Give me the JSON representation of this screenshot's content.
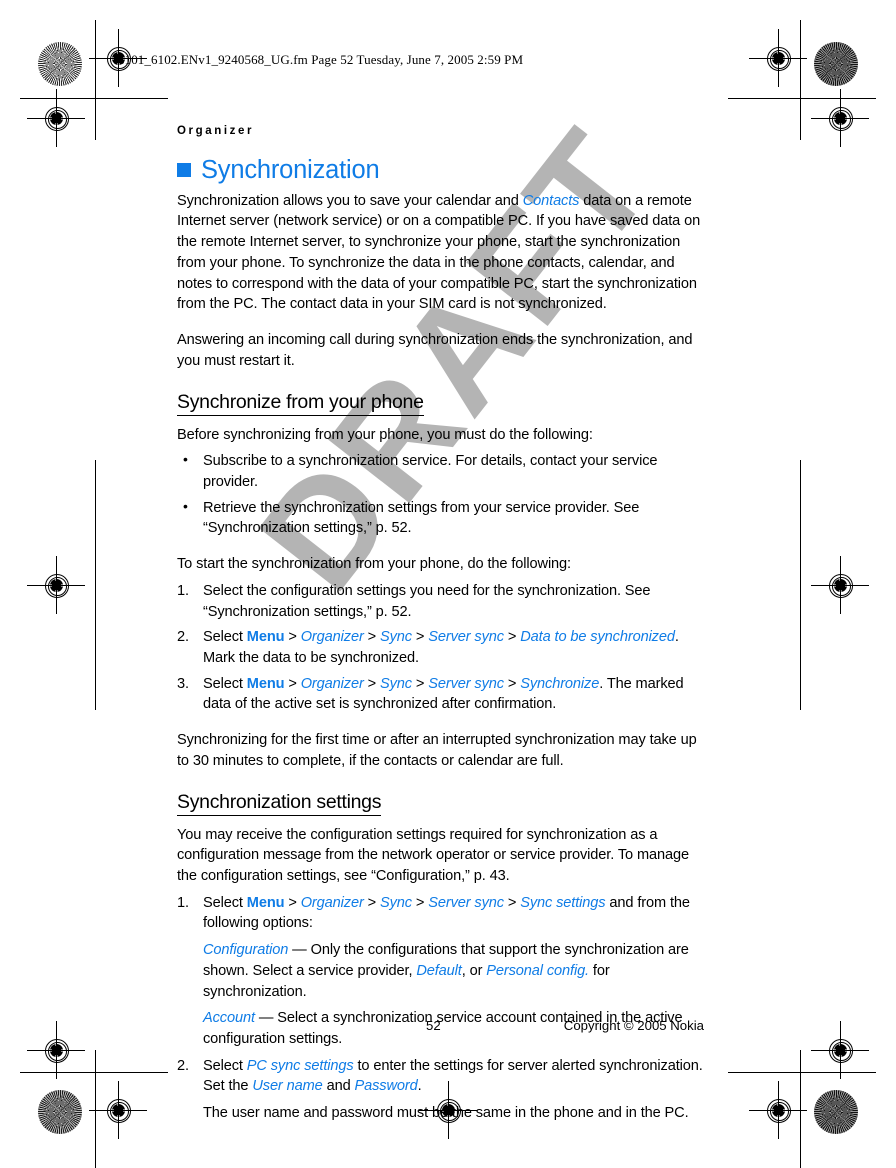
{
  "print_header": {
    "text": "6101_6102.ENv1_9240568_UG.fm  Page 52  Tuesday, June 7, 2005  2:59 PM"
  },
  "watermark": {
    "text": "DRAFT"
  },
  "running_head": {
    "text": "Organizer"
  },
  "chapter": {
    "title": "Synchronization",
    "accent_color": "#0f7ce6"
  },
  "intro": {
    "p1_a": "Synchronization allows you to save your calendar and ",
    "p1_term": "Contacts",
    "p1_b": " data on a remote Internet server (network service) or on a compatible PC. If you have saved data on the remote Internet server, to synchronize your phone, start the synchronization from your phone. To synchronize the data in the phone contacts, calendar, and notes to correspond with the data of your compatible PC, start the synchronization from the PC. The contact data in your SIM card is not synchronized.",
    "p2": "Answering an incoming call during synchronization ends the synchronization, and you must restart it."
  },
  "section_phone": {
    "heading": "Synchronize from your phone",
    "lead": "Before synchronizing from your phone, you must do the following:",
    "bullets": [
      "Subscribe to a synchronization service. For details, contact your service provider.",
      "Retrieve the synchronization settings from your service provider. See “Synchronization settings,” p. 52."
    ],
    "lead2": "To start the synchronization from your phone, do the following:",
    "steps": [
      {
        "num": "1.",
        "text": "Select the configuration settings you need for the synchronization. See “Synchronization settings,” p. 52."
      },
      {
        "num": "2.",
        "prefix": "Select ",
        "menu": "Menu",
        "path": [
          "Organizer",
          "Sync",
          "Server sync",
          "Data to be synchronized"
        ],
        "suffix": ". Mark the data to be synchronized."
      },
      {
        "num": "3.",
        "prefix": "Select ",
        "menu": "Menu",
        "path": [
          "Organizer",
          "Sync",
          "Server sync",
          "Synchronize"
        ],
        "suffix": ". The marked data of the active set is synchronized after confirmation."
      }
    ],
    "closing": "Synchronizing for the first time or after an interrupted synchronization may take up to 30 minutes to complete, if the contacts or calendar are full."
  },
  "section_settings": {
    "heading": "Synchronization settings",
    "lead": "You may receive the configuration settings required for synchronization as a configuration message from the network operator or service provider. To manage the configuration settings, see “Configuration,” p. 43.",
    "step1": {
      "num": "1.",
      "prefix": "Select ",
      "menu": "Menu",
      "path": [
        "Organizer",
        "Sync",
        "Server sync",
        "Sync settings"
      ],
      "suffix": " and from the following options:"
    },
    "definitions": [
      {
        "term": "Configuration",
        "dash": " — ",
        "text_a": "Only the configurations that support the synchronization are shown. Select a service provider, ",
        "opt1": "Default",
        "text_b": ", or ",
        "opt2": "Personal config.",
        "text_c": " for synchronization."
      },
      {
        "term": "Account",
        "dash": " — ",
        "text_a": "Select a synchronization service account contained in the active configuration settings."
      }
    ],
    "step2": {
      "num": "2.",
      "prefix": "Select ",
      "term": "PC sync settings",
      "mid": " to enter the settings for server alerted synchronization. Set the ",
      "term2": "User name",
      "and": " and ",
      "term3": "Password",
      "suffix": "."
    },
    "note": "The user name and password must be the same in the phone and in the PC."
  },
  "footer": {
    "page_number": "52",
    "copyright": "Copyright © 2005 Nokia"
  },
  "separator": ">"
}
